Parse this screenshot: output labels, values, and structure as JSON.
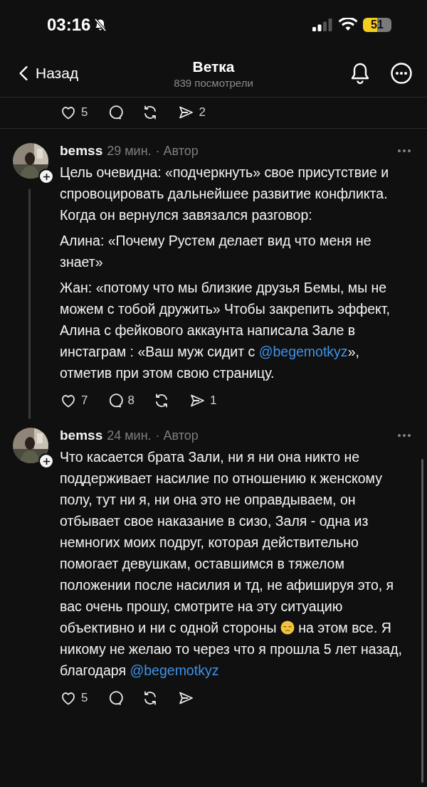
{
  "status_bar": {
    "time": "03:16",
    "battery": "51",
    "silent": true
  },
  "header": {
    "back": "Назад",
    "title": "Ветка",
    "subtitle": "839 посмотрели"
  },
  "previous_actions": [
    {
      "kind": "like",
      "count": "5"
    },
    {
      "kind": "reply"
    },
    {
      "kind": "repost"
    },
    {
      "kind": "share",
      "count": "2"
    }
  ],
  "posts": [
    {
      "author": "bemss",
      "time": "29 мин.",
      "badge": "· Автор",
      "thread_line": true,
      "paragraphs": [
        [
          {
            "kind": "text",
            "text": "Цель очевидна: «подчеркнуть» свое присутствие и спровоцировать дальнейшее развитие конфликта. Когда он вернулся завязался разговор:"
          }
        ],
        [
          {
            "kind": "text",
            "text": "Алина: «Почему Рустем делает вид что меня не знает»"
          }
        ],
        [
          {
            "kind": "text",
            "text": "Жан: «потому что мы близкие друзья Бемы, мы не можем с тобой дружить» Чтобы закрепить эффект, Алина с фейкового аккаунта написала Зале в инстаграм : «Ваш муж сидит с "
          },
          {
            "kind": "mention",
            "text": "@begemotkyz"
          },
          {
            "kind": "text",
            "text": "», отметив при этом свою страницу."
          }
        ]
      ],
      "actions": [
        {
          "kind": "like",
          "count": "7"
        },
        {
          "kind": "reply",
          "count": "8"
        },
        {
          "kind": "repost"
        },
        {
          "kind": "share",
          "count": "1"
        }
      ]
    },
    {
      "author": "bemss",
      "time": "24 мин.",
      "badge": "· Автор",
      "thread_line": false,
      "paragraphs": [
        [
          {
            "kind": "text",
            "text": "Что касается брата Зали, ни я ни она никто не поддерживает насилие по отношению к женскому полу, тут ни я, ни она это не оправдываем, он отбывает свое наказание в сизо, Заля - одна из немногих моих подруг, которая действительно помогает девушкам, оставшимся в тяжелом положении после насилия и тд, не афишируя это, я вас очень прошу, смотрите на эту ситуацию объективно и ни с одной стороны "
          },
          {
            "kind": "emoji"
          },
          {
            "kind": "text",
            "text": " на этом все. Я никому не желаю то через что я прошла 5 лет назад, благодаря "
          },
          {
            "kind": "mention",
            "text": "@begemotkyz"
          }
        ]
      ],
      "actions": [
        {
          "kind": "like",
          "count": "5"
        },
        {
          "kind": "reply"
        },
        {
          "kind": "repost"
        },
        {
          "kind": "share"
        }
      ]
    }
  ]
}
